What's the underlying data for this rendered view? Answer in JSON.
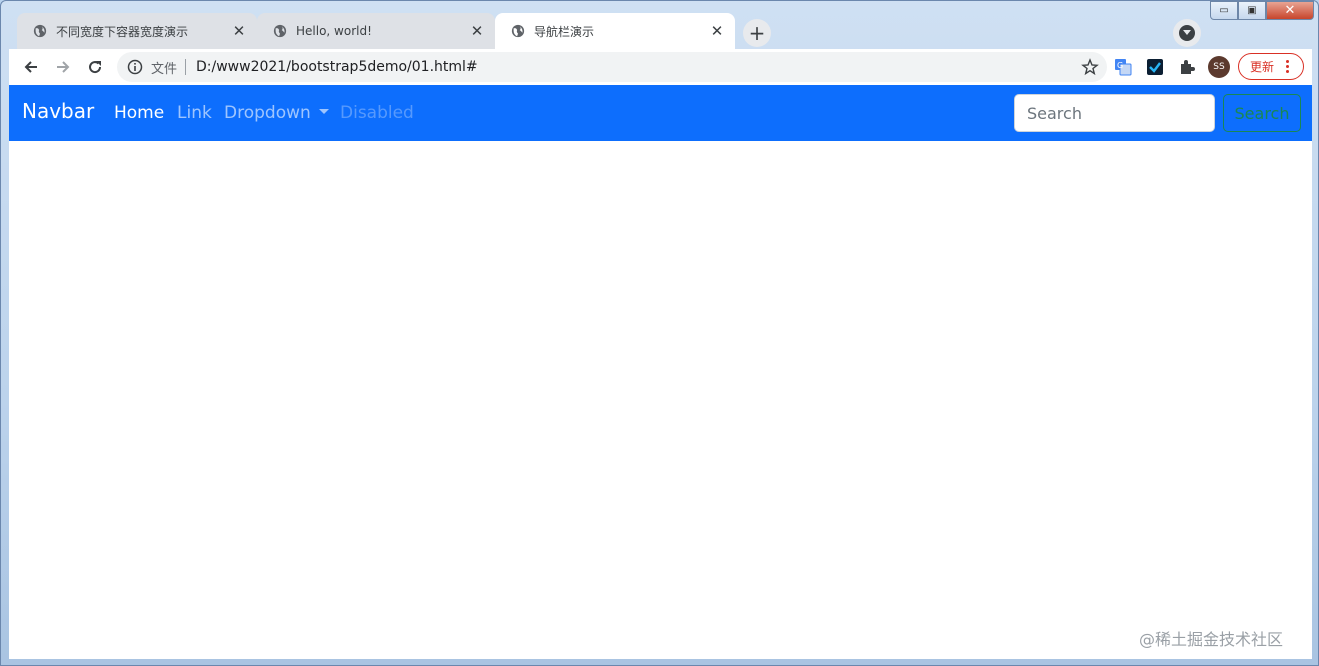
{
  "window": {
    "controls": {
      "minimize": "▭",
      "maximize": "▣",
      "close": "✕"
    }
  },
  "tabs": [
    {
      "title": "不同宽度下容器宽度演示",
      "icon": "globe-icon",
      "active": false
    },
    {
      "title": "Hello, world!",
      "icon": "globe-icon",
      "active": false
    },
    {
      "title": "导航栏演示",
      "icon": "globe-icon",
      "active": true
    }
  ],
  "toolbar": {
    "scheme_label": "文件",
    "url": "D:/www2021/bootstrap5demo/01.html#",
    "avatar_initials": "SS",
    "update_label": "更新"
  },
  "page": {
    "navbar": {
      "brand": "Navbar",
      "links": [
        {
          "label": "Home",
          "state": "active"
        },
        {
          "label": "Link",
          "state": "normal"
        },
        {
          "label": "Dropdown",
          "state": "normal"
        },
        {
          "label": "Disabled",
          "state": "disabled"
        }
      ],
      "search_placeholder": "Search",
      "search_button": "Search"
    }
  },
  "watermark": "@稀土掘金技术社区",
  "colors": {
    "navbar_bg": "#0d6efd",
    "search_button_outline": "#198754",
    "update_button": "#d93025"
  }
}
